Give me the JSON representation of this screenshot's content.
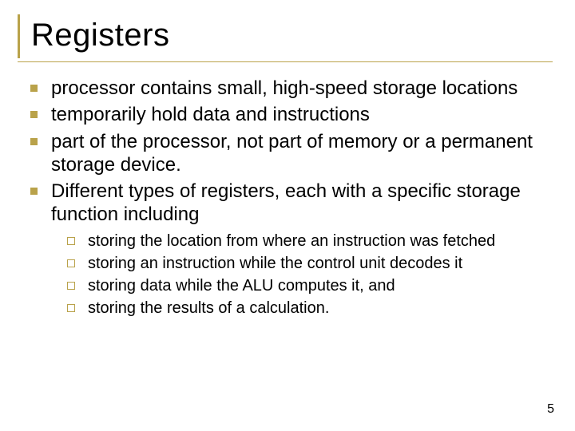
{
  "title": "Registers",
  "bullets": [
    "processor contains small, high-speed storage locations",
    "temporarily hold data and instructions",
    "part of the processor, not part of memory or a permanent storage device.",
    "Different types of registers, each with a specific storage function including"
  ],
  "sub_bullets": [
    "storing the location from where an instruction was fetched",
    "storing an instruction while the control unit decodes it",
    "storing data while the ALU computes it, and",
    "storing the results of a calculation."
  ],
  "page_number": "5"
}
